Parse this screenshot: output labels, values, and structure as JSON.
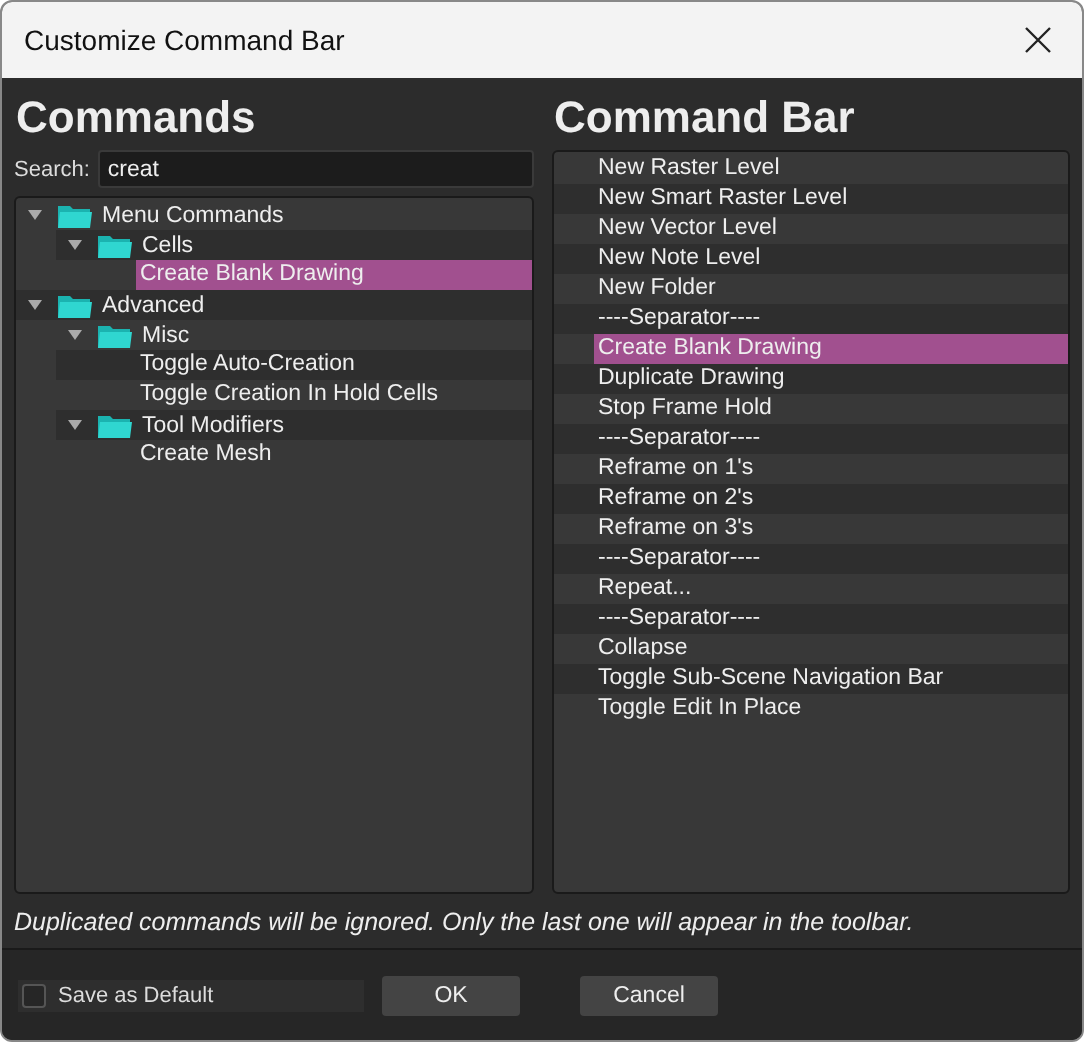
{
  "window": {
    "title": "Customize Command Bar"
  },
  "commands": {
    "heading": "Commands",
    "search_label": "Search:",
    "search_value": "creat",
    "tree": [
      {
        "kind": "folder",
        "label": "Menu Commands",
        "expanded": true,
        "children": [
          {
            "kind": "folder",
            "label": "Cells",
            "expanded": true,
            "children": [
              {
                "kind": "command",
                "label": "Create Blank Drawing",
                "selected": true
              }
            ]
          }
        ]
      },
      {
        "kind": "folder",
        "label": "Advanced",
        "expanded": true,
        "children": [
          {
            "kind": "folder",
            "label": "Misc",
            "expanded": true,
            "children": [
              {
                "kind": "command",
                "label": "Toggle Auto-Creation",
                "selected": false
              },
              {
                "kind": "command",
                "label": "Toggle Creation In Hold Cells",
                "selected": false
              }
            ]
          },
          {
            "kind": "folder",
            "label": "Tool Modifiers",
            "expanded": true,
            "children": [
              {
                "kind": "command",
                "label": "Create Mesh",
                "selected": false
              }
            ]
          }
        ]
      }
    ]
  },
  "command_bar": {
    "heading": "Command Bar",
    "items": [
      {
        "label": "New Raster Level",
        "selected": false
      },
      {
        "label": "New Smart Raster Level",
        "selected": false
      },
      {
        "label": "New Vector Level",
        "selected": false
      },
      {
        "label": "New Note Level",
        "selected": false
      },
      {
        "label": "New Folder",
        "selected": false
      },
      {
        "label": "----Separator----",
        "selected": false
      },
      {
        "label": "Create Blank Drawing",
        "selected": true
      },
      {
        "label": "Duplicate Drawing",
        "selected": false
      },
      {
        "label": "Stop Frame Hold",
        "selected": false
      },
      {
        "label": "----Separator----",
        "selected": false
      },
      {
        "label": "Reframe on 1's",
        "selected": false
      },
      {
        "label": "Reframe on 2's",
        "selected": false
      },
      {
        "label": "Reframe on 3's",
        "selected": false
      },
      {
        "label": "----Separator----",
        "selected": false
      },
      {
        "label": "Repeat...",
        "selected": false
      },
      {
        "label": "----Separator----",
        "selected": false
      },
      {
        "label": "Collapse",
        "selected": false
      },
      {
        "label": "Toggle Sub-Scene Navigation Bar",
        "selected": false
      },
      {
        "label": "Toggle Edit In Place",
        "selected": false
      }
    ]
  },
  "note": "Duplicated commands will be ignored. Only the last one will appear in the toolbar.",
  "footer": {
    "save_default": {
      "label": "Save as Default",
      "checked": false
    },
    "buttons": [
      "OK",
      "Cancel"
    ]
  }
}
